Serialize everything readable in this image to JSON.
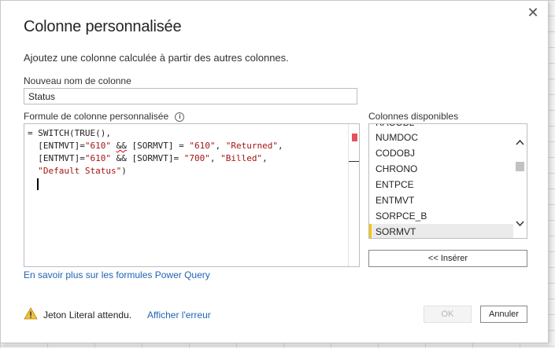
{
  "dialog": {
    "title": "Colonne personnalisée",
    "subtitle": "Ajoutez une colonne calculée à partir des autres colonnes.",
    "close_glyph": "✕"
  },
  "name_field": {
    "label": "Nouveau nom de colonne",
    "value": "Status"
  },
  "formula": {
    "label": "Formule de colonne personnalisée",
    "info_glyph": "i",
    "lines": [
      {
        "prefix": "= SWITCH(TRUE(),",
        "parts": []
      },
      {
        "parts": [
          "  [ENTMVT]=",
          "\"610\"",
          " ",
          "&&",
          " [SORMVT] = ",
          "\"610\"",
          ", ",
          "\"Returned\"",
          ","
        ]
      },
      {
        "parts": [
          "  [ENTMVT]=",
          "\"610\"",
          " && [SORMVT]= ",
          "\"700\"",
          ", ",
          "\"Billed\"",
          ","
        ]
      },
      {
        "parts": [
          "  ",
          "\"Default Status\"",
          ")"
        ]
      }
    ]
  },
  "columns": {
    "label": "Colonnes disponibles",
    "partial_item": "RACOBL",
    "items": [
      "NUMDOC",
      "CODOBJ",
      "CHRONO",
      "ENTPCE",
      "ENTMVT",
      "SORPCE_B",
      "SORMVT"
    ],
    "selected": "SORMVT",
    "insert_label": "<< Insérer"
  },
  "learn_link": "En savoir plus sur les formules Power Query",
  "status": {
    "warning_icon": "warning-icon",
    "message": "Jeton Literal attendu.",
    "link": "Afficher l'erreur"
  },
  "buttons": {
    "ok": "OK",
    "cancel": "Annuler"
  },
  "colors": {
    "accent_selected": "#f2c811",
    "link": "#1f64b4",
    "string_literal": "#a31515"
  }
}
